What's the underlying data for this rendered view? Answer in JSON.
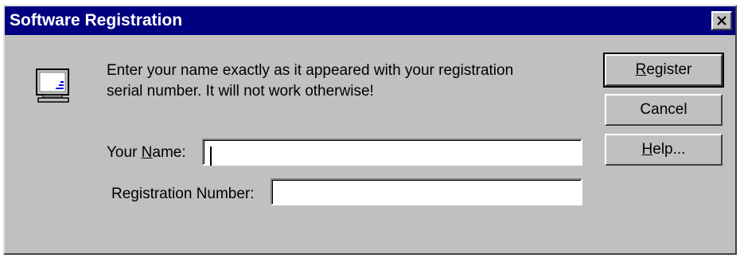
{
  "window": {
    "title": "Software Registration",
    "title_bar_color": "#000080",
    "close_icon": "close-icon"
  },
  "message": {
    "line1": "Enter your name exactly as it appeared with your registration",
    "line2": "serial number.  It will not work otherwise!"
  },
  "icon": "monitor-icon",
  "name_field": {
    "label_prefix": "Your ",
    "label_mnemonic": "N",
    "label_suffix": "ame:",
    "value": ""
  },
  "regnum_field": {
    "label": "Registration Number:",
    "value": ""
  },
  "buttons": {
    "register": {
      "mnemonic": "R",
      "rest": "egister"
    },
    "cancel": {
      "label": "Cancel"
    },
    "help": {
      "mnemonic": "H",
      "rest": "elp..."
    }
  }
}
